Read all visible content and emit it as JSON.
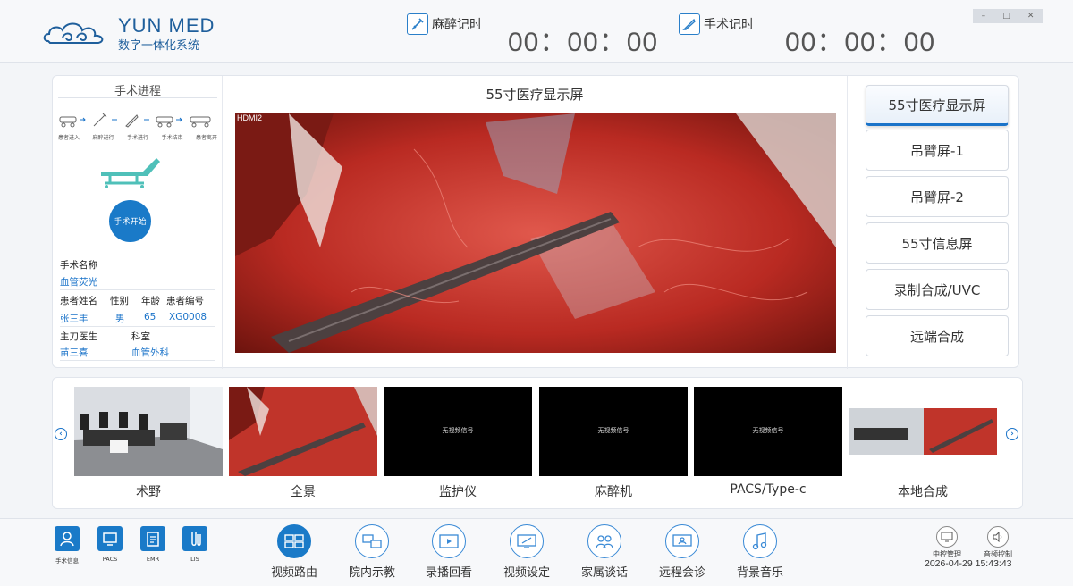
{
  "header": {
    "logo_title": "YUN MED",
    "logo_subtitle": "数字一体化系统",
    "anesthesia_timer_label": "麻醉记时",
    "anesthesia_timer_value": "00：00：00",
    "surgery_timer_label": "手术记时",
    "surgery_timer_value": "00：00：00"
  },
  "progress": {
    "title": "手术进程",
    "steps": [
      "患者进入",
      "麻醉进行",
      "手术进行",
      "手术结束",
      "患者离开"
    ],
    "start_button": "手术开始",
    "surgery_name_label": "手术名称",
    "surgery_name_value": "血管荧光",
    "patient_headers": [
      "患者姓名",
      "性别",
      "年龄",
      "患者编号"
    ],
    "patient_values": [
      "张三丰",
      "男",
      "65",
      "XG0008"
    ],
    "doctor_label": "主刀医生",
    "department_label": "科室",
    "doctor_value": "苗三喜",
    "department_value": "血管外科"
  },
  "display": {
    "title": "55寸医疗显示屏",
    "input_label": "HDMI2"
  },
  "outputs": [
    "55寸医疗显示屏",
    "吊臂屏-1",
    "吊臂屏-2",
    "55寸信息屏",
    "录制合成/UVC",
    "远端合成"
  ],
  "sources": [
    {
      "label": "术野",
      "signal": ""
    },
    {
      "label": "全景",
      "signal": ""
    },
    {
      "label": "监护仪",
      "signal": "无视频信号"
    },
    {
      "label": "麻醉机",
      "signal": "无视频信号"
    },
    {
      "label": "PACS/Type-c",
      "signal": "无视频信号"
    },
    {
      "label": "本地合成",
      "signal": ""
    }
  ],
  "footer": {
    "systems": [
      "手术信息",
      "PACS",
      "EMR",
      "LIS"
    ],
    "menu": [
      "视频路由",
      "院内示教",
      "录播回看",
      "视频设定",
      "家属谈话",
      "远程会诊",
      "背景音乐"
    ],
    "controls": [
      "中控管理",
      "音频控制"
    ],
    "datetime": "2026-04-29 15:43:43"
  },
  "colors": {
    "accent": "#1a73c9",
    "button_blue": "#1a7ac8"
  }
}
